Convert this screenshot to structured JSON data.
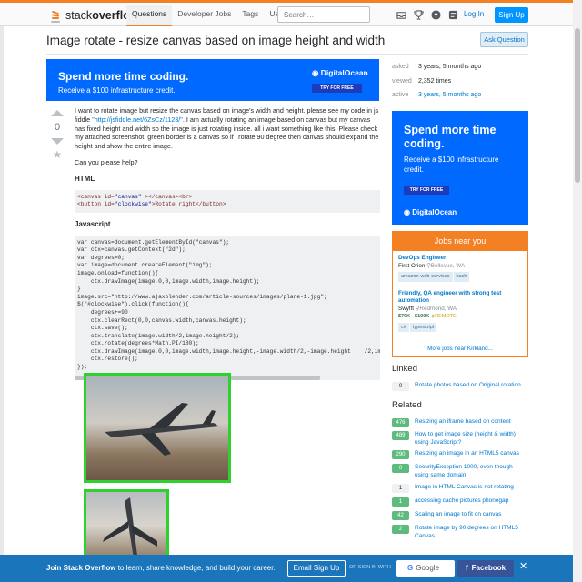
{
  "header": {
    "logo_prefix": "stack",
    "logo_bold": "overflow",
    "nav": [
      "Questions",
      "Developer Jobs",
      "Tags",
      "Users"
    ],
    "search_placeholder": "Search…",
    "login": "Log In",
    "signup": "Sign Up",
    "icons": [
      "inbox-icon",
      "trophy-icon",
      "help-icon",
      "review-icon"
    ]
  },
  "question": {
    "title": "Image rotate - resize canvas based on image height and width",
    "ask_button": "Ask Question",
    "votes": "0",
    "body_1": "I want to rotate image but resize the canvas based on image's width and height. please see my code in js fiddle ",
    "body_link": "\"http://jsfiddle.net/6ZsCz/1123/\"",
    "body_2": ". I am actually rotating an image based on canvas but my canvas has fixed height and width so the image is just rotating inside. all i want something like this. Please check my attached screenshot. green border is a canvas so if i rotate 90 degree then canvas should expand the height and show the entire image.",
    "help": "Can you please help?",
    "html_heading": "HTML",
    "html_line1_a": "<canvas ",
    "html_line1_attr": "id=",
    "html_line1_val": "\"canvas\"",
    "html_line1_b": " ></canvas><br>",
    "html_line2_a": "<button ",
    "html_line2_attr": "id=",
    "html_line2_val": "\"clockwise\"",
    "html_line2_b": ">Rotate right</button>",
    "js_heading": "Javascript",
    "js_code": "var canvas=document.getElementById(\"canvas\");\nvar ctx=canvas.getContext(\"2d\");\nvar degrees=0;\nvar image=document.createElement(\"img\");\nimage.onload=function(){\n    ctx.drawImage(image,0,0,image.width,image.height);\n}\nimage.src=\"http://www.ajaxblender.com/article-sources/images/plane-1.jpg\";\n$(\"#clockwise\").click(function(){\n    degrees+=90\n    ctx.clearRect(0,0,canvas.width,canvas.height);\n    ctx.save();\n    ctx.translate(image.width/2,image.height/2);\n    ctx.rotate(degrees*Math.PI/180);\n    ctx.drawImage(image,0,0,image.width,image.height,-image.width/2,-image.height    /2,image.w\n    ctx.restore();\n});"
  },
  "ads": {
    "banner_line1": "Spend more time coding.",
    "banner_line2": "Receive a $100 infrastructure credit.",
    "brand": "DigitalOcean",
    "try_free": "TRY FOR FREE",
    "side_line1": "Spend more time coding.",
    "side_line2": "Receive a $100 infrastructure credit."
  },
  "meta": {
    "asked_label": "asked",
    "asked_value": "3 years, 5 months ago",
    "viewed_label": "viewed",
    "viewed_value": "2,352 times",
    "active_label": "active",
    "active_value": "3 years, 5 months ago"
  },
  "jobs": {
    "heading": "Jobs near you",
    "items": [
      {
        "title": "DevOps Engineer",
        "company": "First Orion",
        "location": "Bellevue, WA",
        "tags": [
          "amazon-web-services",
          "bash"
        ]
      },
      {
        "title": "Friendly, QA engineer with strong test automation",
        "company": "Swyfft",
        "location": "Redmond, WA",
        "salary": "$70K - $100K",
        "remote": "REMOTE",
        "tags": [
          "c#",
          "typescript"
        ]
      }
    ],
    "more": "More jobs near Kirkland..."
  },
  "linked": {
    "heading": "Linked",
    "items": [
      {
        "count": "0",
        "title": "Rotate photos based on Original rotation",
        "accepted": false
      }
    ]
  },
  "related": {
    "heading": "Related",
    "items": [
      {
        "count": "476",
        "title": "Resizing an iframe based on content",
        "accepted": true
      },
      {
        "count": "489",
        "title": "How to get image size (height & width) using JavaScript?",
        "accepted": true
      },
      {
        "count": "290",
        "title": "Resizing an image in an HTML5 canvas",
        "accepted": true
      },
      {
        "count": "0",
        "title": "SecurityException 1000, even though using same domain",
        "accepted": true
      },
      {
        "count": "1",
        "title": "Image in HTML Canvas is not rotating",
        "accepted": false
      },
      {
        "count": "1",
        "title": "accessing cache pictures phonegap",
        "accepted": true
      },
      {
        "count": "42",
        "title": "Scaling an image to fit on canvas",
        "accepted": true
      },
      {
        "count": "2",
        "title": "Rotate image by 90 degrees on HTML5 Canvas",
        "accepted": true
      }
    ]
  },
  "footer_bar": {
    "text_bold": "Join Stack Overflow",
    "text_rest": " to learn, share knowledge, and build your career.",
    "email_signup": "Email Sign Up",
    "or_text": "OR SIGN IN WITH",
    "google": "Google",
    "facebook": "Facebook"
  },
  "colors": {
    "accent": "#f48024",
    "link": "#0077cc",
    "ad_blue": "#0069ff",
    "canvas_border": "#2fd12f",
    "accepted_badge": "#5eba7d",
    "bottom_bar": "#1b75bb"
  }
}
